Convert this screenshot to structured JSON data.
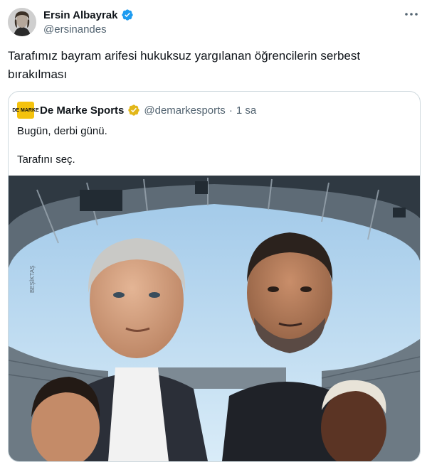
{
  "author": {
    "display_name": "Ersin Albayrak",
    "handle": "@ersinandes",
    "verified": true,
    "avatar_icon": "profile-avatar"
  },
  "tweet": {
    "text": "Tarafımız bayram arifesi hukuksuz yargılanan öğrencilerin serbest bırakılması"
  },
  "quoted": {
    "logo_text": "DE MARKE",
    "display_name": "De Marke Sports",
    "verified_badge": "gold",
    "handle": "@demarkesports",
    "separator": "·",
    "time": "1 sa",
    "text_line1": "Bugün, derbi günü.",
    "text_line2": "Tarafını seç.",
    "image_watermark": "BEŞİKTAŞ"
  },
  "icons": {
    "verified": "verified-badge-icon",
    "gold_verified": "gold-verified-badge-icon",
    "more": "more-options-icon"
  },
  "colors": {
    "verified_blue": "#1d9bf0",
    "gold": "#e2b719",
    "muted_text": "#536471",
    "border": "#cfd9de",
    "brand_yellow": "#f4c20d"
  }
}
